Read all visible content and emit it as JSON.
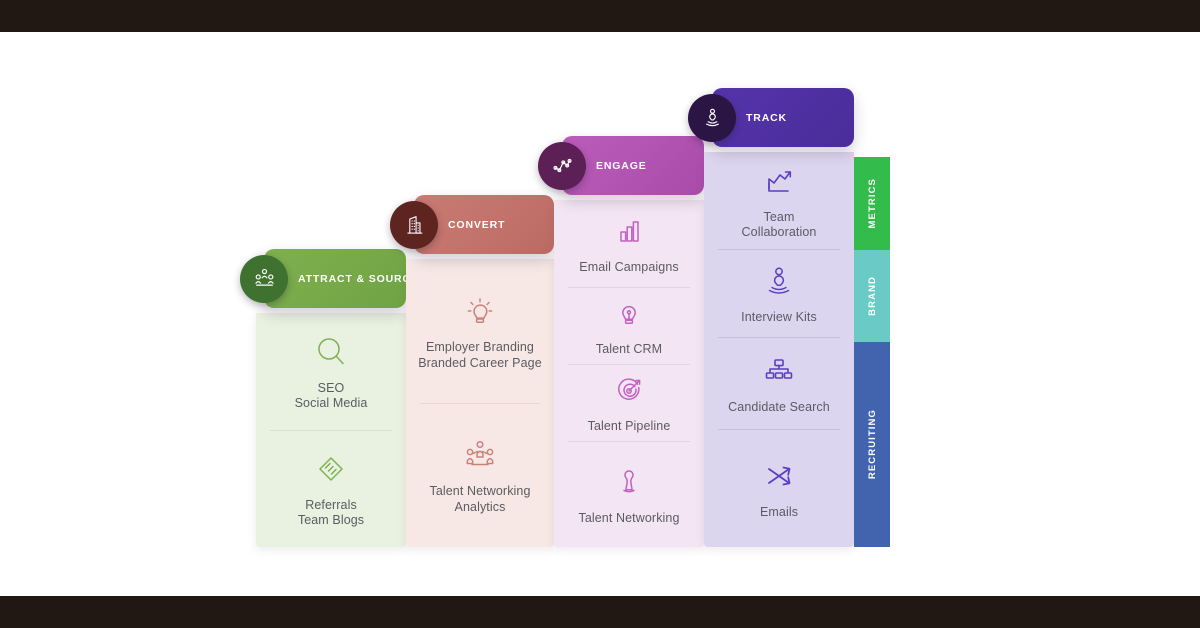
{
  "frame": {
    "top_bar_color": "#211814",
    "bottom_bar_color": "#211814",
    "background": "#ffffff"
  },
  "columns": [
    {
      "key": "attract",
      "title": "ATTRACT & SOURCE",
      "badge_icon": "people-group-icon",
      "pill_color": "#7fb04f",
      "pill_color_dark": "#6fa343",
      "badge_color": "#3f7230",
      "body_color": "#e9f1e1",
      "divider_color": "#d4e2c6",
      "icon_color": "#7cb24f",
      "items": [
        {
          "icon": "magnifier-icon",
          "lines": [
            "SEO",
            "Social Media"
          ]
        },
        {
          "icon": "handshake-icon",
          "lines": [
            "Referrals",
            "Team Blogs"
          ]
        }
      ]
    },
    {
      "key": "convert",
      "title": "CONVERT",
      "badge_icon": "building-icon",
      "pill_color": "#c97b72",
      "pill_color_dark": "#bc6b63",
      "badge_color": "#5d2420",
      "body_color": "#f7e8e6",
      "divider_color": "#ecd6d3",
      "icon_color": "#cc8079",
      "items": [
        {
          "icon": "lightbulb-idea-icon",
          "lines": [
            "Employer Branding",
            "Branded Career Page"
          ]
        },
        {
          "icon": "people-network-icon",
          "lines": [
            "Talent Networking",
            "Analytics"
          ]
        }
      ]
    },
    {
      "key": "engage",
      "title": "ENGAGE",
      "badge_icon": "line-chart-icon",
      "pill_color": "#bb5cbb",
      "pill_color_dark": "#a94ca9",
      "badge_color": "#5c1f56",
      "body_color": "#f3e5f3",
      "divider_color": "#e6d2e6",
      "icon_color": "#c062c0",
      "items": [
        {
          "icon": "bar-chart-icon",
          "lines": [
            "Email Campaigns"
          ]
        },
        {
          "icon": "lightbulb-icon",
          "lines": [
            "Talent CRM"
          ]
        },
        {
          "icon": "target-icon",
          "lines": [
            "Talent Pipeline"
          ]
        },
        {
          "icon": "person-icon",
          "lines": [
            "Talent Networking"
          ]
        }
      ]
    },
    {
      "key": "track",
      "title": "TRACK",
      "badge_icon": "podium-person-icon",
      "pill_color": "#5534ab",
      "pill_color_dark": "#4a2c99",
      "badge_color": "#2a1545",
      "body_color": "#dcd5ef",
      "divider_color": "#c8bfe4",
      "icon_color": "#5a3fc0",
      "items": [
        {
          "icon": "growth-chart-icon",
          "lines": [
            "Team",
            "Collaboration"
          ]
        },
        {
          "icon": "podium-person-icon",
          "lines": [
            "Interview Kits"
          ]
        },
        {
          "icon": "org-chart-icon",
          "lines": [
            "Candidate Search"
          ]
        },
        {
          "icon": "shuffle-arrows-icon",
          "lines": [
            "Emails"
          ]
        }
      ]
    }
  ],
  "rail": [
    {
      "label": "METRICS",
      "color": "#33bb4c"
    },
    {
      "label": "BRAND",
      "color": "#69cac6"
    },
    {
      "label": "RECRUITING",
      "color": "#4264ae"
    }
  ]
}
